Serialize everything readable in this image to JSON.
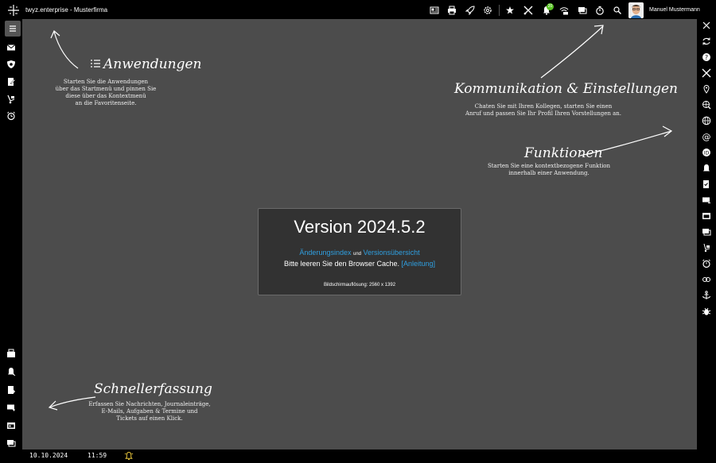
{
  "window": {
    "title": "twyz.enterprise - Musterfirma"
  },
  "header": {
    "icons": [
      "news-icon",
      "print-icon",
      "rocket-icon",
      "settings-icon",
      "favorite-icon",
      "tools-icon",
      "notification-icon",
      "wifi-icon",
      "chat-icon",
      "timer-icon",
      "search-icon"
    ],
    "notification_count": "20",
    "user_name": "Manuel Mustermann"
  },
  "hints": {
    "apps": {
      "title": "Anwendungen",
      "text": "Starten Sie die Anwendungen\nüber das Startmenü und pinnen Sie\ndiese über das Kontextmenü\nan die Favoritenseite."
    },
    "comm": {
      "title": "Kommunikation & Einstellungen",
      "text": "Chaten Sie mit Ihren Kollegen, starten Sie einen\nAnruf und passen Sie Ihr Profil Ihren Vorstellungen an."
    },
    "functions": {
      "title": "Funktionen",
      "text": "Starten Sie eine kontextbezogene Funktion\ninnerhalb einer Anwendung."
    },
    "quick": {
      "title": "Schnellerfassung",
      "text": "Erfassen Sie Nachrichten, Journaleinträge,\nE-Mails, Aufgaben & Termine und\nTickets auf einen Klick."
    }
  },
  "version_box": {
    "title": "Version 2024.5.2",
    "change_index": "Änderungsindex",
    "and_word": "und",
    "version_overview": "Versionsübersicht",
    "cache_text": "Bitte leeren Sie den Browser Cache.",
    "guide_link": "[Anleitung]",
    "resolution": "Bildschirmauflösung: 2560 x 1392"
  },
  "footer": {
    "date": "10.10.2024",
    "time": "11:59"
  },
  "colors": {
    "background": "#4c4c4c",
    "link": "#2f9fe0",
    "badge": "#58c322",
    "bell": "#e5c33a"
  }
}
